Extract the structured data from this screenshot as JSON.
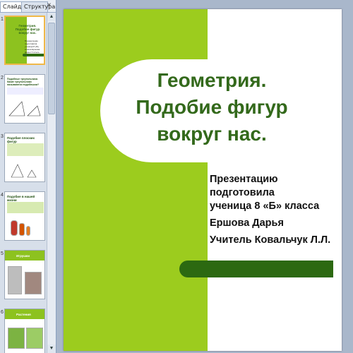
{
  "left_panel": {
    "tabs": [
      {
        "label": "Слайды",
        "active": true
      },
      {
        "label": "Структура",
        "active": false
      }
    ],
    "close_glyph": "×",
    "thumbnails": [
      {
        "number": "1",
        "title": "Геометрия. Подобие фигур вокруг нас.",
        "text": "Презентацию подготовила ученица 8 «Б» класса Ершова Дарья Учитель Ковальчук Л.Л."
      },
      {
        "number": "2",
        "title": "Подобные треугольники. Какие треугольники называются подобными?",
        "text": ""
      },
      {
        "number": "3",
        "title": "Подобие плоских фигур",
        "text": ""
      },
      {
        "number": "4",
        "title": "Подобие в нашей жизни",
        "text": ""
      },
      {
        "number": "5",
        "title": "Игрушки",
        "text": ""
      },
      {
        "number": "6",
        "title": "Растения",
        "text": ""
      }
    ]
  },
  "slide": {
    "title_lines": [
      "Геометрия.",
      "Подобие фигур",
      "вокруг нас."
    ],
    "subtitle_lines": [
      "Презентацию подготовила",
      "ученица 8 «Б» класса",
      "Ершова Дарья",
      "Учитель Ковальчук Л.Л."
    ]
  },
  "colors": {
    "green": "#9ccc1e",
    "dark_green": "#2c6911",
    "title": "#33691b"
  }
}
